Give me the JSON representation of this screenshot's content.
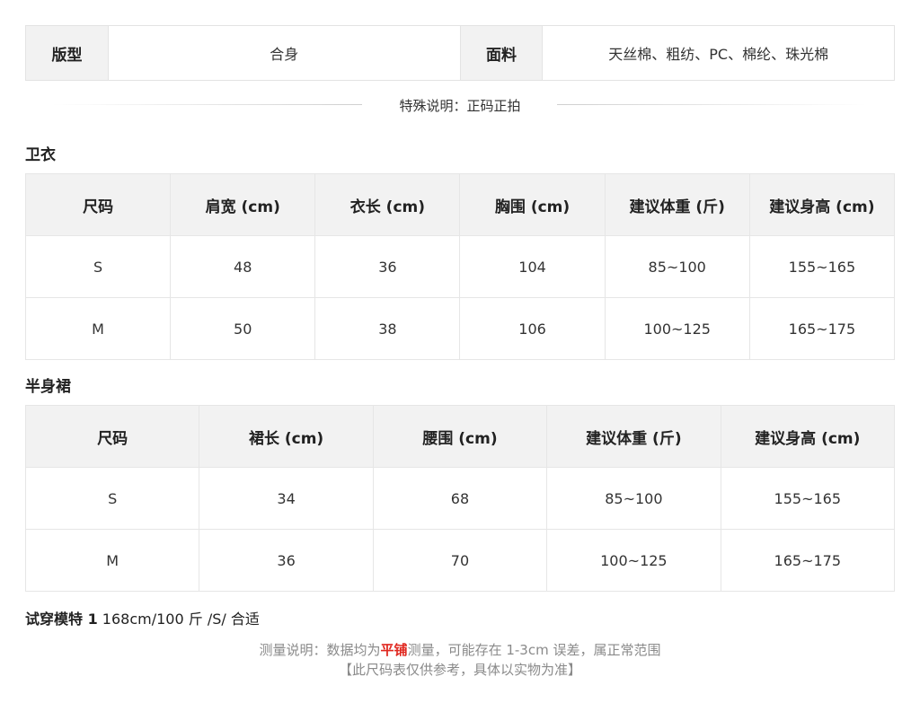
{
  "spec": {
    "fit_label": "版型",
    "fit_value": "合身",
    "fabric_label": "面料",
    "fabric_value": "天丝棉、粗纺、PC、棉纶、珠光棉"
  },
  "special_note": "特殊说明：正码正拍",
  "hoodie": {
    "title": "卫衣",
    "headers": [
      "尺码",
      "肩宽 (cm)",
      "衣长 (cm)",
      "胸围 (cm)",
      "建议体重 (斤)",
      "建议身高 (cm)"
    ],
    "rows": [
      [
        "S",
        "48",
        "36",
        "104",
        "85~100",
        "155~165"
      ],
      [
        "M",
        "50",
        "38",
        "106",
        "100~125",
        "165~175"
      ]
    ]
  },
  "skirt": {
    "title": "半身裙",
    "headers": [
      "尺码",
      "裙长 (cm)",
      "腰围 (cm)",
      "建议体重 (斤)",
      "建议身高 (cm)"
    ],
    "rows": [
      [
        "S",
        "34",
        "68",
        "85~100",
        "155~165"
      ],
      [
        "M",
        "36",
        "70",
        "100~125",
        "165~175"
      ]
    ]
  },
  "model": {
    "label": "试穿模特 1",
    "value": " 168cm/100 斤 /S/ 合适"
  },
  "footer": {
    "line1_before": "测量说明：数据均为",
    "line1_highlight": "平铺",
    "line1_after": "测量，可能存在 1-3cm 误差，属正常范围",
    "line2": "【此尺码表仅供参考，具体以实物为准】",
    "highlight_color": "#e0271f"
  }
}
